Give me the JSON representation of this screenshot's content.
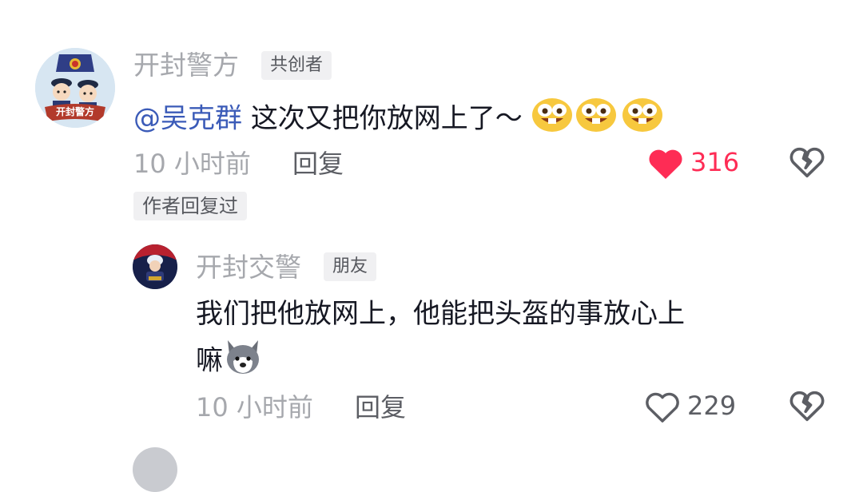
{
  "comments": [
    {
      "author": "开封警方",
      "badge": "共创者",
      "avatar_text": "开封警方",
      "mention": "@吴克群",
      "text": "这次又把你放网上了～",
      "emojis": [
        "grin-teeth-emoji",
        "grin-teeth-emoji",
        "grin-teeth-emoji"
      ],
      "time": "10 小时前",
      "reply_label": "回复",
      "likes": "316",
      "liked": true,
      "author_replied_tag": "作者回复过"
    }
  ],
  "replies": [
    {
      "author": "开封交警",
      "badge": "朋友",
      "text_line1": "我们把他放网上，他能把头盔的事放心上",
      "text_line2": "嘛",
      "emoji": "husky-dog-emoji",
      "time": "10 小时前",
      "reply_label": "回复",
      "likes": "229",
      "liked": false
    }
  ],
  "colors": {
    "like_active": "#fe2c55",
    "mention": "#3b5bb8",
    "muted": "#a6a8ad"
  }
}
